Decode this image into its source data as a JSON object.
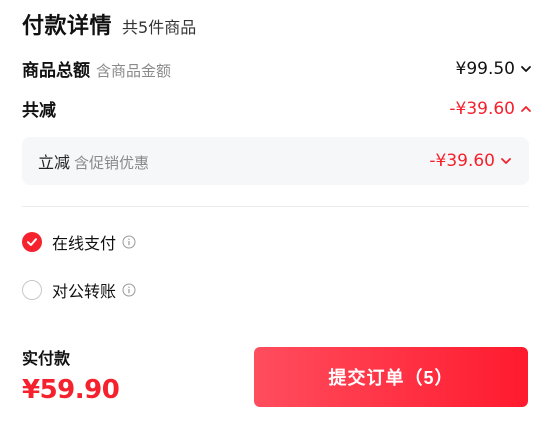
{
  "header": {
    "title": "付款详情",
    "subtitle": "共5件商品"
  },
  "summary": {
    "goods_total": {
      "label": "商品总额",
      "hint": "含商品金额",
      "amount": "¥99.50"
    },
    "total_reduction": {
      "label": "共减",
      "amount": "-¥39.60"
    },
    "instant_discount": {
      "label": "立减",
      "hint": "含促销优惠",
      "amount": "-¥39.60"
    }
  },
  "payment_options": [
    {
      "label": "在线支付",
      "selected": true
    },
    {
      "label": "对公转账",
      "selected": false
    }
  ],
  "footer": {
    "pay_label": "实付款",
    "pay_amount": "¥59.90",
    "submit_label": "提交订单（5）"
  },
  "colors": {
    "accent": "#f5222d",
    "button_start": "#ff4d5e",
    "button_end": "#ff1a2e"
  }
}
